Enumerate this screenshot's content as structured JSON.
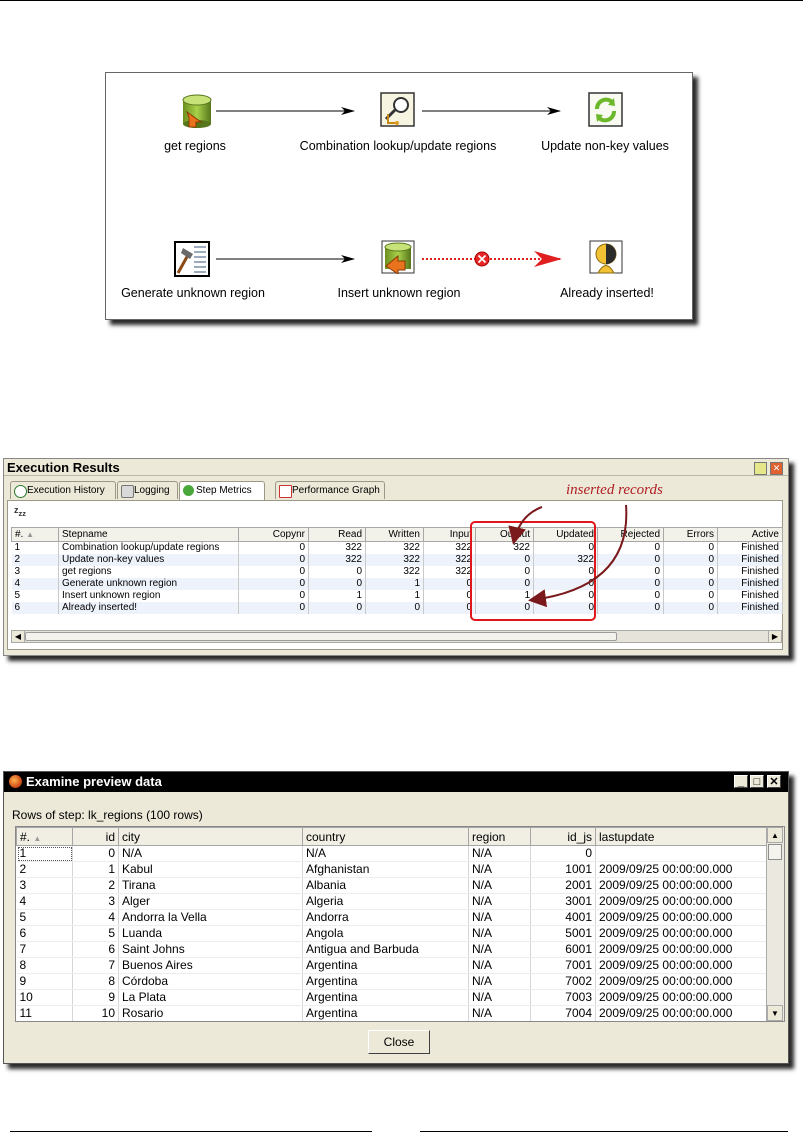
{
  "transformation": {
    "steps": [
      {
        "label": "get regions",
        "icon": "table-input-icon"
      },
      {
        "label": "Combination lookup/update regions",
        "icon": "combination-lookup-icon"
      },
      {
        "label": "Update non-key values",
        "icon": "update-icon"
      },
      {
        "label": "Generate unknown region",
        "icon": "generate-rows-icon"
      },
      {
        "label": "Insert unknown region",
        "icon": "table-output-icon"
      },
      {
        "label": "Already inserted!",
        "icon": "dummy-icon"
      }
    ]
  },
  "execution_results": {
    "title": "Execution Results",
    "tabs": [
      "Execution History",
      "Logging",
      "Step Metrics",
      "Performance Graph"
    ],
    "active_tab": "Step Metrics",
    "annotation": "inserted records",
    "columns": [
      "#.",
      "Stepname",
      "Copynr",
      "Read",
      "Written",
      "Input",
      "Output",
      "Updated",
      "Rejected",
      "Errors",
      "Active"
    ],
    "rows": [
      [
        "1",
        "Combination lookup/update regions",
        "0",
        "322",
        "322",
        "322",
        "322",
        "0",
        "0",
        "0",
        "Finished"
      ],
      [
        "2",
        "Update non-key values",
        "0",
        "322",
        "322",
        "322",
        "0",
        "322",
        "0",
        "0",
        "Finished"
      ],
      [
        "3",
        "get regions",
        "0",
        "0",
        "322",
        "322",
        "0",
        "0",
        "0",
        "0",
        "Finished"
      ],
      [
        "4",
        "Generate unknown region",
        "0",
        "0",
        "1",
        "0",
        "0",
        "0",
        "0",
        "0",
        "Finished"
      ],
      [
        "5",
        "Insert unknown region",
        "0",
        "1",
        "1",
        "0",
        "1",
        "0",
        "0",
        "0",
        "Finished"
      ],
      [
        "6",
        "Already inserted!",
        "0",
        "0",
        "0",
        "0",
        "0",
        "0",
        "0",
        "0",
        "Finished"
      ]
    ]
  },
  "preview": {
    "title": "Examine preview data",
    "rows_label": "Rows of step: lk_regions (100 rows)",
    "columns": [
      "#.",
      "id",
      "city",
      "country",
      "region",
      "id_js",
      "lastupdate"
    ],
    "rows": [
      [
        "1",
        "0",
        "N/A",
        "N/A",
        "N/A",
        "0",
        ""
      ],
      [
        "2",
        "1",
        "Kabul",
        "Afghanistan",
        "N/A",
        "1001",
        "2009/09/25 00:00:00.000"
      ],
      [
        "3",
        "2",
        "Tirana",
        "Albania",
        "N/A",
        "2001",
        "2009/09/25 00:00:00.000"
      ],
      [
        "4",
        "3",
        "Alger",
        "Algeria",
        "N/A",
        "3001",
        "2009/09/25 00:00:00.000"
      ],
      [
        "5",
        "4",
        "Andorra la Vella",
        "Andorra",
        "N/A",
        "4001",
        "2009/09/25 00:00:00.000"
      ],
      [
        "6",
        "5",
        "Luanda",
        "Angola",
        "N/A",
        "5001",
        "2009/09/25 00:00:00.000"
      ],
      [
        "7",
        "6",
        "Saint Johns",
        "Antigua and Barbuda",
        "N/A",
        "6001",
        "2009/09/25 00:00:00.000"
      ],
      [
        "8",
        "7",
        "Buenos Aires",
        "Argentina",
        "N/A",
        "7001",
        "2009/09/25 00:00:00.000"
      ],
      [
        "9",
        "8",
        "Córdoba",
        "Argentina",
        "N/A",
        "7002",
        "2009/09/25 00:00:00.000"
      ],
      [
        "10",
        "9",
        "La Plata",
        "Argentina",
        "N/A",
        "7003",
        "2009/09/25 00:00:00.000"
      ],
      [
        "11",
        "10",
        "Rosario",
        "Argentina",
        "N/A",
        "7004",
        "2009/09/25 00:00:00.000"
      ]
    ],
    "close_label": "Close"
  }
}
